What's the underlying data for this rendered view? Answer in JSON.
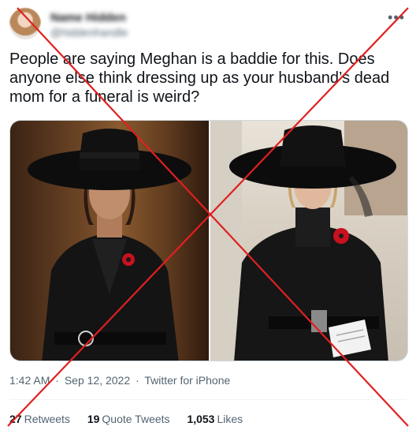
{
  "author": {
    "display_name": "Name Hidden",
    "handle": "@hiddenhandle"
  },
  "more_icon": "more-horizontal-icon",
  "tweet": {
    "text": "People are saying Meghan is a baddie for this. Does anyone else think dressing up as your husband’s dead mom for a funeral is weird?"
  },
  "meta": {
    "time": "1:42 AM",
    "dot": "·",
    "date": "Sep 12, 2022",
    "source": "Twitter for iPhone"
  },
  "stats": {
    "retweets_count": "27",
    "retweets_label": "Retweets",
    "quotes_count": "19",
    "quotes_label": "Quote Tweets",
    "likes_count": "1,053",
    "likes_label": "Likes"
  },
  "colors": {
    "cross": "#e02020",
    "text": "#0f1419",
    "muted": "#536471"
  }
}
